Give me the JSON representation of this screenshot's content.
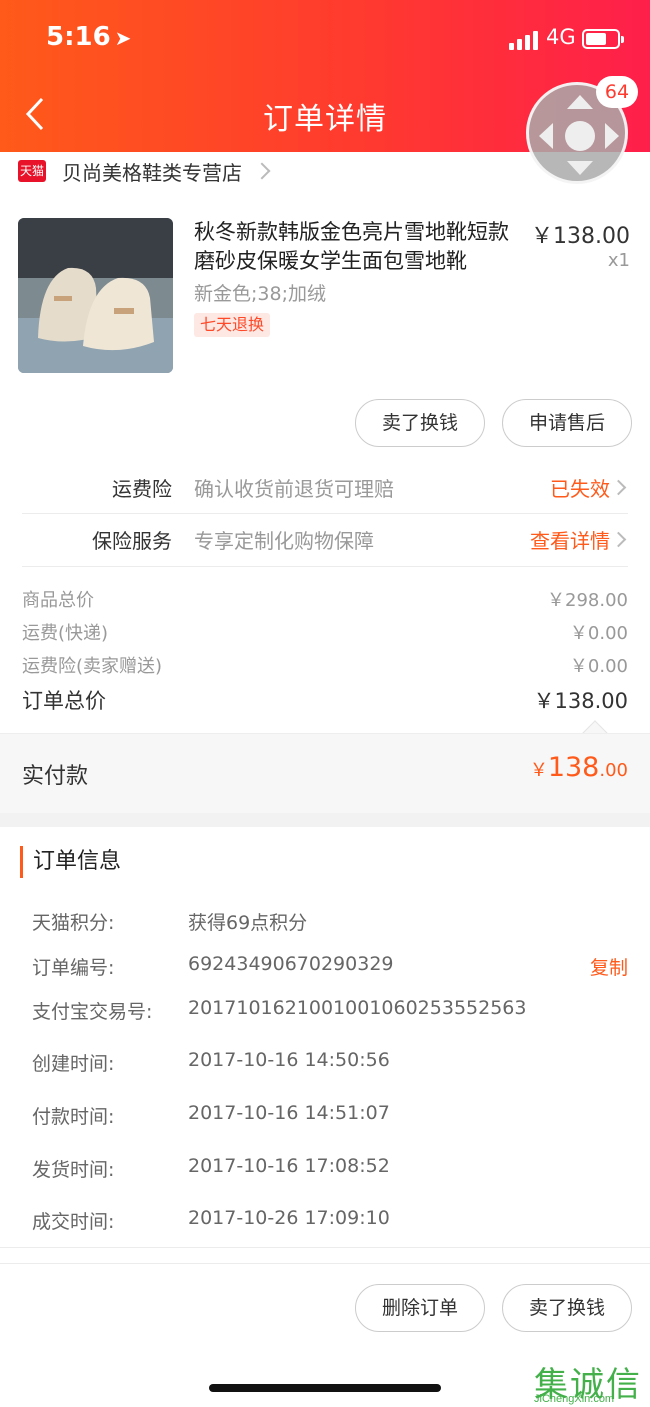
{
  "status_bar": {
    "time": "5:16",
    "network": "4G"
  },
  "header": {
    "title": "订单详情"
  },
  "assistive_touch": {
    "badge": "64"
  },
  "store": {
    "badge": "天猫",
    "name": "贝尚美格鞋类专营店"
  },
  "product": {
    "name": "秋冬新款韩版金色亮片雪地靴短款磨砂皮保暖女学生面包雪地靴",
    "price": "￥138.00",
    "qty": "x1",
    "sku": "新金色;38;加绒",
    "tag": "七天退换"
  },
  "item_actions": {
    "sell": "卖了换钱",
    "after_sale": "申请售后"
  },
  "insurance": [
    {
      "label": "运费险",
      "desc": "确认收货前退货可理赔",
      "action": "已失效"
    },
    {
      "label": "保险服务",
      "desc": "专享定制化购物保障",
      "action": "查看详情"
    }
  ],
  "summary": {
    "rows": [
      {
        "label": "商品总价",
        "value": "￥298.00"
      },
      {
        "label": "运费(快递)",
        "value": "￥0.00"
      },
      {
        "label": "运费险(卖家赠送)",
        "value": "￥0.00"
      }
    ],
    "total_label": "订单总价",
    "total_value": "￥138.00"
  },
  "paid": {
    "label": "实付款",
    "currency": "￥",
    "integer": "138",
    "decimal": ".00"
  },
  "order_info": {
    "title": "订单信息",
    "copy_label": "复制",
    "rows": [
      {
        "label": "天猫积分:",
        "value": "获得69点积分"
      },
      {
        "label": "订单编号:",
        "value": "69243490670290329"
      },
      {
        "label": "支付宝交易号:",
        "value": "2017101621001001060253552563"
      },
      {
        "label": "创建时间:",
        "value": "2017-10-16 14:50:56"
      },
      {
        "label": "付款时间:",
        "value": "2017-10-16 14:51:07"
      },
      {
        "label": "发货时间:",
        "value": "2017-10-16 17:08:52"
      },
      {
        "label": "成交时间:",
        "value": "2017-10-26 17:09:10"
      }
    ]
  },
  "bottom_actions": {
    "delete": "删除订单",
    "sell": "卖了换钱"
  },
  "watermark": {
    "glyph": "集诚信",
    "sub": "JiChengXin.com"
  },
  "colors": {
    "accent": "#ff5a1a",
    "header_start": "#ff5a1a",
    "header_end": "#ff1f4b"
  }
}
